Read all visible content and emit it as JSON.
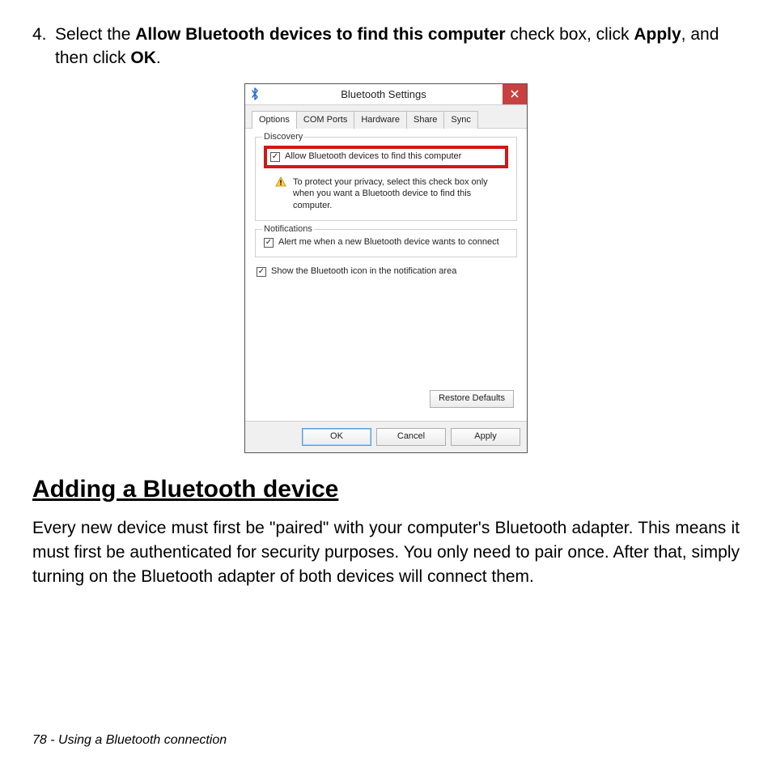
{
  "step": {
    "number": "4.",
    "prefix": "Select the ",
    "bold1": "Allow Bluetooth devices to find this computer",
    "mid1": " check box, click ",
    "bold2": "Apply",
    "mid2": ", and then click ",
    "bold3": "OK",
    "suffix": "."
  },
  "dialog": {
    "title": "Bluetooth Settings",
    "tabs": [
      "Options",
      "COM Ports",
      "Hardware",
      "Share",
      "Sync"
    ],
    "discovery": {
      "legend": "Discovery",
      "checkbox_label": "Allow Bluetooth devices to find this computer",
      "warning": "To protect your privacy, select this check box only when you want a Bluetooth device to find this computer."
    },
    "notifications": {
      "legend": "Notifications",
      "checkbox_label": "Alert me when a new Bluetooth device wants to connect"
    },
    "show_icon_label": "Show the Bluetooth icon in the notification area",
    "restore_defaults": "Restore Defaults",
    "ok": "OK",
    "cancel": "Cancel",
    "apply": "Apply"
  },
  "section": {
    "heading": "Adding a Bluetooth device",
    "paragraph": "Every new device must first be \"paired\" with your computer's Bluetooth adapter. This means it must first be authenticated for security purposes. You only need to pair once. After that, simply turning on the Bluetooth adapter of both devices will connect them."
  },
  "footer": "78 - Using a Bluetooth connection"
}
